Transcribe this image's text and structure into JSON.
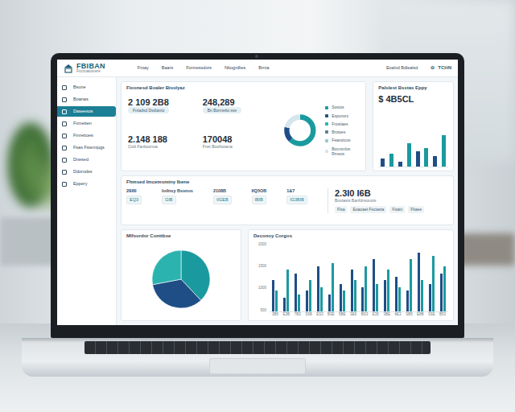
{
  "topbar": {
    "logo": "FBIBAN",
    "logo_subtitle": "Fncnuaiosnere",
    "nav": [
      "Froay",
      "Baars",
      "Fonnessdors",
      "Nbogrdlies",
      "Brnta"
    ],
    "account": "Eoalxd Bdlealsd",
    "user_icon": "⊖",
    "user": "TCHN"
  },
  "sidebar": {
    "items": [
      {
        "label": "Bsune",
        "selected": false
      },
      {
        "label": "Boanas",
        "selected": false
      },
      {
        "label": "Daseesos",
        "selected": true
      },
      {
        "label": "Fxmetten",
        "selected": false
      },
      {
        "label": "Fmrettoes",
        "selected": false
      },
      {
        "label": "Fsas Fstemipgs",
        "selected": false
      },
      {
        "label": "Dnesed",
        "selected": false
      },
      {
        "label": "Ddorodss",
        "selected": false
      },
      {
        "label": "Eppery",
        "selected": false
      }
    ]
  },
  "summary": {
    "title": "Fioonesd Boaler Bisslyaz",
    "metrics": [
      {
        "value": "2 109 2B8",
        "note": "Fntadsd Dsdtanio",
        "kind": "pill"
      },
      {
        "value": "248,289",
        "note": "Bn Bonnetlo sse",
        "kind": "pill"
      },
      {
        "value": "2.148 188",
        "note": "Ciolt Fanboonoa",
        "kind": "plain"
      },
      {
        "value": "170048",
        "note": "Fnet Boollssiana",
        "kind": "plain"
      }
    ],
    "donut": {
      "segments": [
        {
          "value": 62,
          "color": "#1a9a9f"
        },
        {
          "value": 16,
          "color": "#1f4e86"
        },
        {
          "value": 22,
          "color": "#d5e6ec"
        }
      ],
      "legend": [
        {
          "label": "Sostos",
          "color": "#1a9a9f"
        },
        {
          "label": "Espunsrs",
          "color": "#1f4e86"
        },
        {
          "label": "Fnoslaes",
          "color": "#2bb3b0"
        },
        {
          "label": "Brotoes",
          "color": "#5b7f95"
        },
        {
          "label": "Feanotcos",
          "color": "#9cc6d1"
        },
        {
          "label": "Bocnsnlos Rmeos",
          "color": "#d5e6ec"
        }
      ]
    }
  },
  "spend": {
    "title": "Palslest Bsstas Eppy",
    "value": "$ 4B5CL",
    "series": [
      {
        "color": "#1f4e86",
        "values": [
          3,
          2,
          6,
          4
        ]
      },
      {
        "color": "#1a9a9f",
        "values": [
          5,
          9,
          7,
          12
        ]
      }
    ]
  },
  "ledger": {
    "title": "Fhmsed Imcemsminy Ibene",
    "columns": [
      {
        "head": "2ßI6I",
        "value": "EQ3"
      },
      {
        "head": "Ioilnsy Bssnos",
        "value": "GIB"
      },
      {
        "head": "2108B",
        "value": "IIGEB"
      },
      {
        "head": "IIQ5OB",
        "value": "IBIB"
      },
      {
        "head": "1&7",
        "value": "IG3BIB"
      }
    ],
    "feature": {
      "value": "2.3I0 I6B",
      "note": "Bnotasts Banfdnsonots",
      "tags": [
        "Flsa",
        "Eoaoaet Fsctasta",
        "Foatn",
        "Fltaee"
      ]
    }
  },
  "breakdown": {
    "title": "Mlfsordor Conttbse",
    "segments": [
      {
        "value": 38,
        "color": "#1a9a9f"
      },
      {
        "value": 34,
        "color": "#1f4e86"
      },
      {
        "value": 28,
        "color": "#2bb3b0"
      }
    ]
  },
  "trend": {
    "title": "Deconoy Corgos",
    "y_ticks": [
      "2000",
      "1500",
      "1000",
      "500"
    ],
    "x_labels": [
      "3B5",
      "E3B",
      "7B3",
      "3SB",
      "ES3",
      "B3E",
      "5BE",
      "3E8",
      "BS3",
      "E35",
      "3BE",
      "8E3",
      "SB5",
      "E8B",
      "3SE",
      "B53"
    ],
    "series": [
      {
        "color": "#1f4e86",
        "values": [
          900,
          400,
          1100,
          600,
          1300,
          500,
          800,
          1200,
          700,
          1500,
          900,
          1000,
          600,
          1700,
          800,
          1100
        ]
      },
      {
        "color": "#1a9a9f",
        "values": [
          600,
          1200,
          500,
          900,
          700,
          1400,
          600,
          900,
          1300,
          800,
          1200,
          700,
          1500,
          900,
          1600,
          1300
        ]
      }
    ]
  }
}
